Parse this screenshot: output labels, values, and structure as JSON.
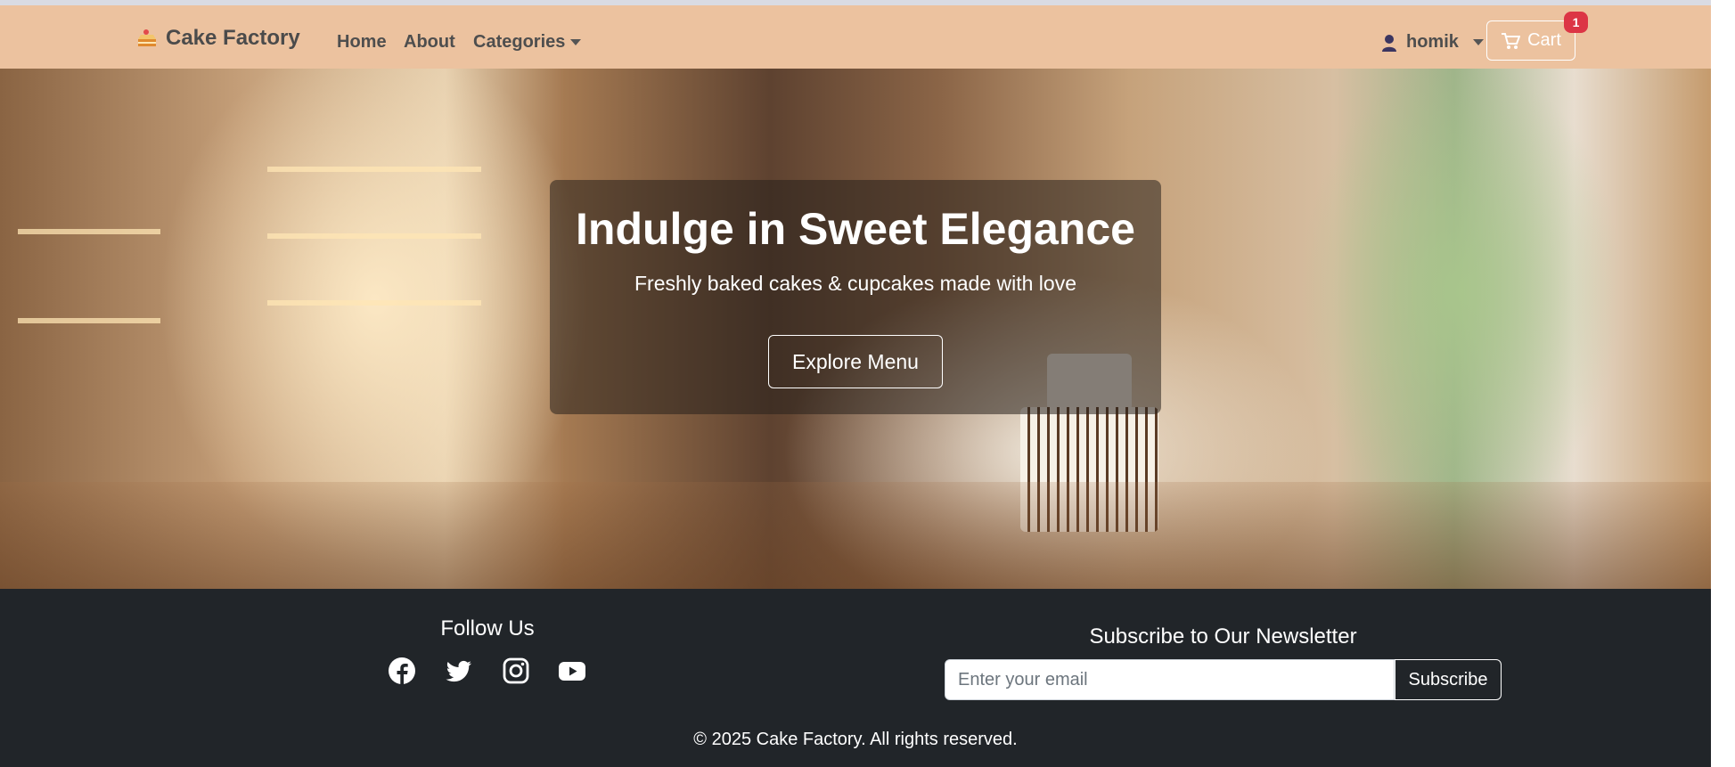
{
  "navbar": {
    "brand": "Cake Factory",
    "links": [
      "Home",
      "About",
      "Categories"
    ],
    "user": "homik",
    "cart_label": "Cart",
    "cart_count": "1"
  },
  "hero": {
    "title": "Indulge in Sweet Elegance",
    "subtitle": "Freshly baked cakes & cupcakes made with love",
    "button": "Explore Menu"
  },
  "footer": {
    "follow_title": "Follow Us",
    "social_icons": [
      "facebook-icon",
      "twitter-icon",
      "instagram-icon",
      "youtube-icon"
    ],
    "newsletter_title": "Subscribe to Our Newsletter",
    "email_placeholder": "Enter your email",
    "subscribe_button": "Subscribe",
    "copyright": "© 2025 Cake Factory. All rights reserved."
  },
  "colors": {
    "navbar_bg": "#ecc29f",
    "footer_bg": "#212529",
    "badge": "#dc3545"
  }
}
